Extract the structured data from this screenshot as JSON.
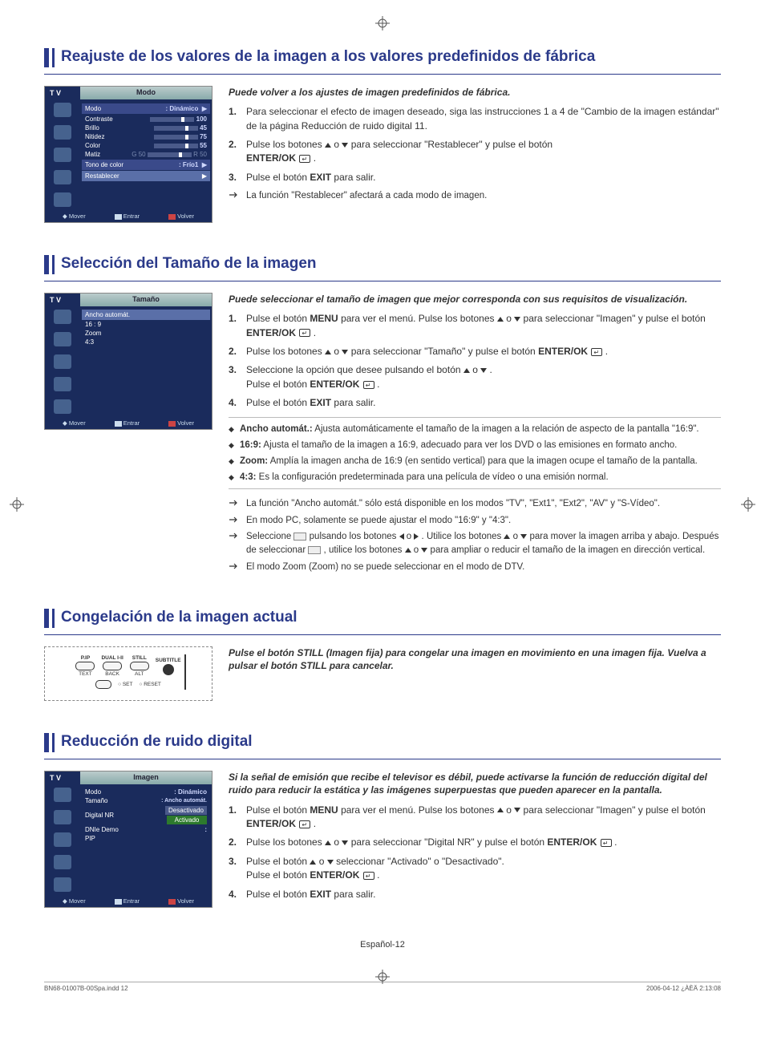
{
  "page": {
    "number_label": "Español-12",
    "footer_left": "BN68-01007B-00Spa.indd   12",
    "footer_right": "2006-04-12   ¿ÀÈÄ 2:13:08"
  },
  "sections": {
    "s1": {
      "title": "Reajuste de los valores de la imagen a los valores predefinidos de fábrica",
      "intro": "Puede volver a los ajustes de imagen predefinidos de fábrica.",
      "steps": {
        "1": "Para seleccionar el efecto de imagen deseado, siga las instrucciones 1 a 4 de \"Cambio de la imagen estándar\" de la página Reducción de ruido digital 11.",
        "2a": "Pulse los botones ",
        "2b": " o ",
        "2c": " para seleccionar \"Restablecer\" y pulse el botón ",
        "2d": "ENTER/OK",
        "3a": "Pulse el botón ",
        "3b": "EXIT",
        "3c": " para salir."
      },
      "note": "La función \"Restablecer\" afectará a cada modo de imagen.",
      "osd": {
        "tv": "T V",
        "title": "Modo",
        "rows": {
          "modo": {
            "label": "Modo",
            "value": ": Dinámico"
          },
          "contraste": {
            "label": "Contraste",
            "value": "100"
          },
          "brillo": {
            "label": "Brillo",
            "value": "45"
          },
          "nitidez": {
            "label": "Nitidez",
            "value": "75"
          },
          "color": {
            "label": "Color",
            "value": "55"
          },
          "matiz": {
            "label": "Matiz",
            "left": "G 50",
            "right": "R 50"
          },
          "tono": {
            "label": "Tono de color",
            "value": ": Frío1"
          },
          "restablecer": {
            "label": "Restablecer"
          }
        },
        "footer": {
          "mover": "Mover",
          "entrar": "Entrar",
          "volver": "Volver"
        }
      }
    },
    "s2": {
      "title": "Selección del Tamaño de la imagen",
      "intro": "Puede seleccionar el tamaño de imagen que mejor corresponda con sus requisitos de visualización.",
      "steps": {
        "1a": "Pulse el botón ",
        "1b": "MENU",
        "1c": " para ver el menú. Pulse los botones ",
        "1d": " o ",
        "1e": " para seleccionar \"Imagen\" y pulse el botón ",
        "1f": "ENTER/OK",
        "2a": "Pulse los botones ",
        "2b": " o ",
        "2c": " para seleccionar \"Tamaño\" y pulse el botón ",
        "2d": "ENTER/OK",
        "3a": "Seleccione la opción que desee pulsando el botón ",
        "3b": " o ",
        "3c": " .",
        "3d": "Pulse el botón ",
        "3e": "ENTER/OK",
        "4a": "Pulse el botón ",
        "4b": "EXIT",
        "4c": " para salir."
      },
      "bullets": {
        "b1a": "Ancho automát.:",
        "b1b": " Ajusta automáticamente el tamaño de la imagen a la relación de aspecto de la pantalla \"16:9\".",
        "b2a": "16:9:",
        "b2b": " Ajusta el tamaño de la imagen a 16:9, adecuado para ver los DVD o las emisiones en formato ancho.",
        "b3a": "Zoom:",
        "b3b": " Amplía la imagen ancha de 16:9 (en sentido vertical) para que la imagen ocupe el tamaño de la pantalla.",
        "b4a": "4:3:",
        "b4b": " Es la configuración predeterminada para una película de vídeo o una emisión normal."
      },
      "notes": {
        "n1": "La función \"Ancho automát.\" sólo está disponible en los modos \"TV\", \"Ext1\", \"Ext2\", \"AV\" y \"S-Vídeo\".",
        "n2": "En modo PC, solamente se puede ajustar el modo \"16:9\" y \"4:3\".",
        "n3a": "Seleccione ",
        "n3b": " pulsando los botones ",
        "n3c": " o ",
        "n3d": " . Utilice los botones ",
        "n3e": " o ",
        "n3f": " para mover la imagen arriba y abajo. Después de seleccionar ",
        "n3g": " , utilice los botones ",
        "n3h": " o ",
        "n3i": " para ampliar o reducir el tamaño de la imagen en dirección vertical.",
        "n4": "El modo Zoom (Zoom) no se puede seleccionar en el modo de DTV."
      },
      "osd": {
        "tv": "T V",
        "title": "Tamaño",
        "opts": {
          "o1": "Ancho automát.",
          "o2": "16 : 9",
          "o3": "Zoom",
          "o4": "4:3"
        },
        "footer": {
          "mover": "Mover",
          "entrar": "Entrar",
          "volver": "Volver"
        }
      }
    },
    "s3": {
      "title": "Congelación de la imagen actual",
      "intro": "Pulse el botón STILL (Imagen fija) para congelar una imagen en movimiento en una imagen fija. Vuelva a pulsar el botón STILL para cancelar.",
      "remote": {
        "pip": "P.IP",
        "dual": "DUAL I-II",
        "still": "STILL",
        "subtitle": "SUBTITLE",
        "text": "TEXT",
        "back": "BACK",
        "alt": "ALT",
        "set": "SET",
        "reset": "RESET"
      }
    },
    "s4": {
      "title": "Reducción de ruido digital",
      "intro": "Si la señal de emisión que recibe el televisor es débil, puede activarse la función de reducción digital del ruido para reducir la estática y las imágenes superpuestas que pueden aparecer en la pantalla.",
      "steps": {
        "1a": "Pulse el botón ",
        "1b": "MENU",
        "1c": " para ver el menú. Pulse los botones ",
        "1d": " o ",
        "1e": " para seleccionar \"Imagen\" y pulse el botón ",
        "1f": "ENTER/OK",
        "2a": "Pulse los botones ",
        "2b": " o ",
        "2c": " para seleccionar \"Digital NR\" y pulse el botón ",
        "2d": "ENTER/OK",
        "3a": "Pulse el botón ",
        "3b": " o ",
        "3c": " seleccionar \"Activado\" o \"Desactivado\".",
        "3d": "Pulse el botón ",
        "3e": "ENTER/OK",
        "4a": "Pulse el botón ",
        "4b": "EXIT",
        "4c": " para salir."
      },
      "osd": {
        "tv": "T V",
        "title": "Imagen",
        "rows": {
          "modo": {
            "label": "Modo",
            "value": ": Dinámico"
          },
          "tamano": {
            "label": "Tamaño",
            "value": ": Ancho automát."
          },
          "digitalnr": {
            "label": "Digital NR",
            "opt1": "Desactivado",
            "opt2": "Activado"
          },
          "dnie": {
            "label": "DNIe Demo",
            "value": ":"
          },
          "pip": {
            "label": "PIP"
          }
        },
        "footer": {
          "mover": "Mover",
          "entrar": "Entrar",
          "volver": "Volver"
        }
      }
    }
  }
}
